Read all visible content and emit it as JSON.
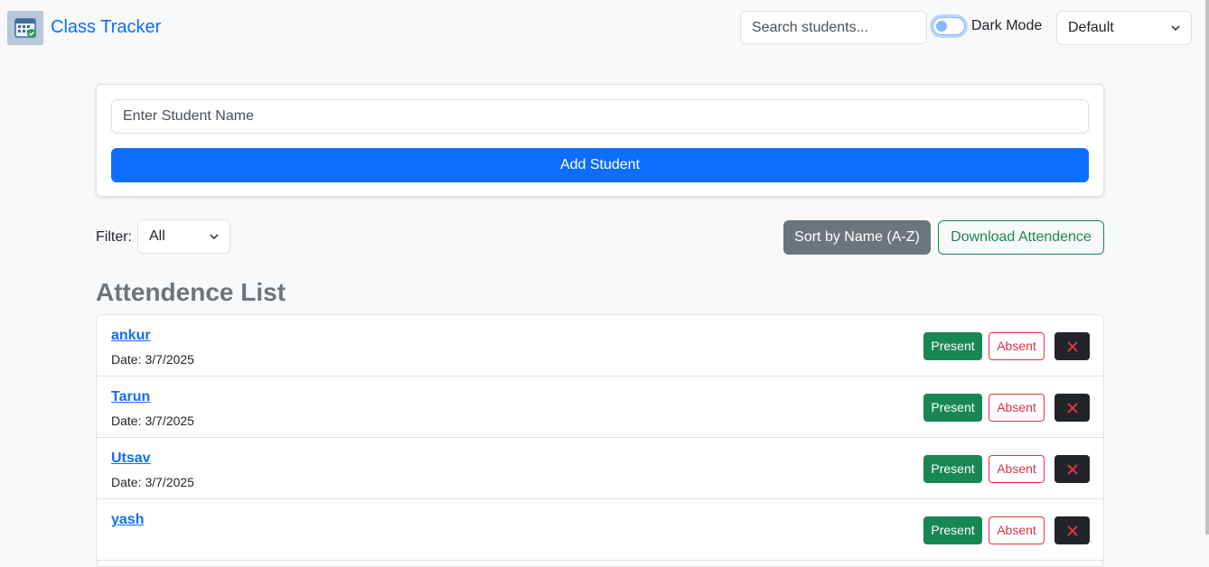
{
  "header": {
    "brand": "Class Tracker",
    "logo_icon": "attendance-logo-icon",
    "search_placeholder": "Search students...",
    "dark_mode_label": "Dark Mode",
    "dark_mode_on": false,
    "theme_selected": "Default"
  },
  "add_form": {
    "name_placeholder": "Enter Student Name",
    "add_label": "Add Student"
  },
  "controls": {
    "filter_label": "Filter:",
    "filter_selected": "All",
    "sort_label": "Sort by Name (A-Z)",
    "download_label": "Download Attendence"
  },
  "list": {
    "title": "Attendence List",
    "date_label": "Date:",
    "present_label": "Present",
    "absent_label": "Absent",
    "delete_icon": "close-icon",
    "students": [
      {
        "name": "ankur",
        "date": "3/7/2025"
      },
      {
        "name": "Tarun",
        "date": "3/7/2025"
      },
      {
        "name": "Utsav",
        "date": "3/7/2025"
      },
      {
        "name": "yash",
        "date": ""
      }
    ]
  },
  "colors": {
    "primary": "#0d6efd",
    "success": "#198754",
    "danger": "#dc3545",
    "secondary": "#6c757d",
    "dark": "#212529"
  }
}
